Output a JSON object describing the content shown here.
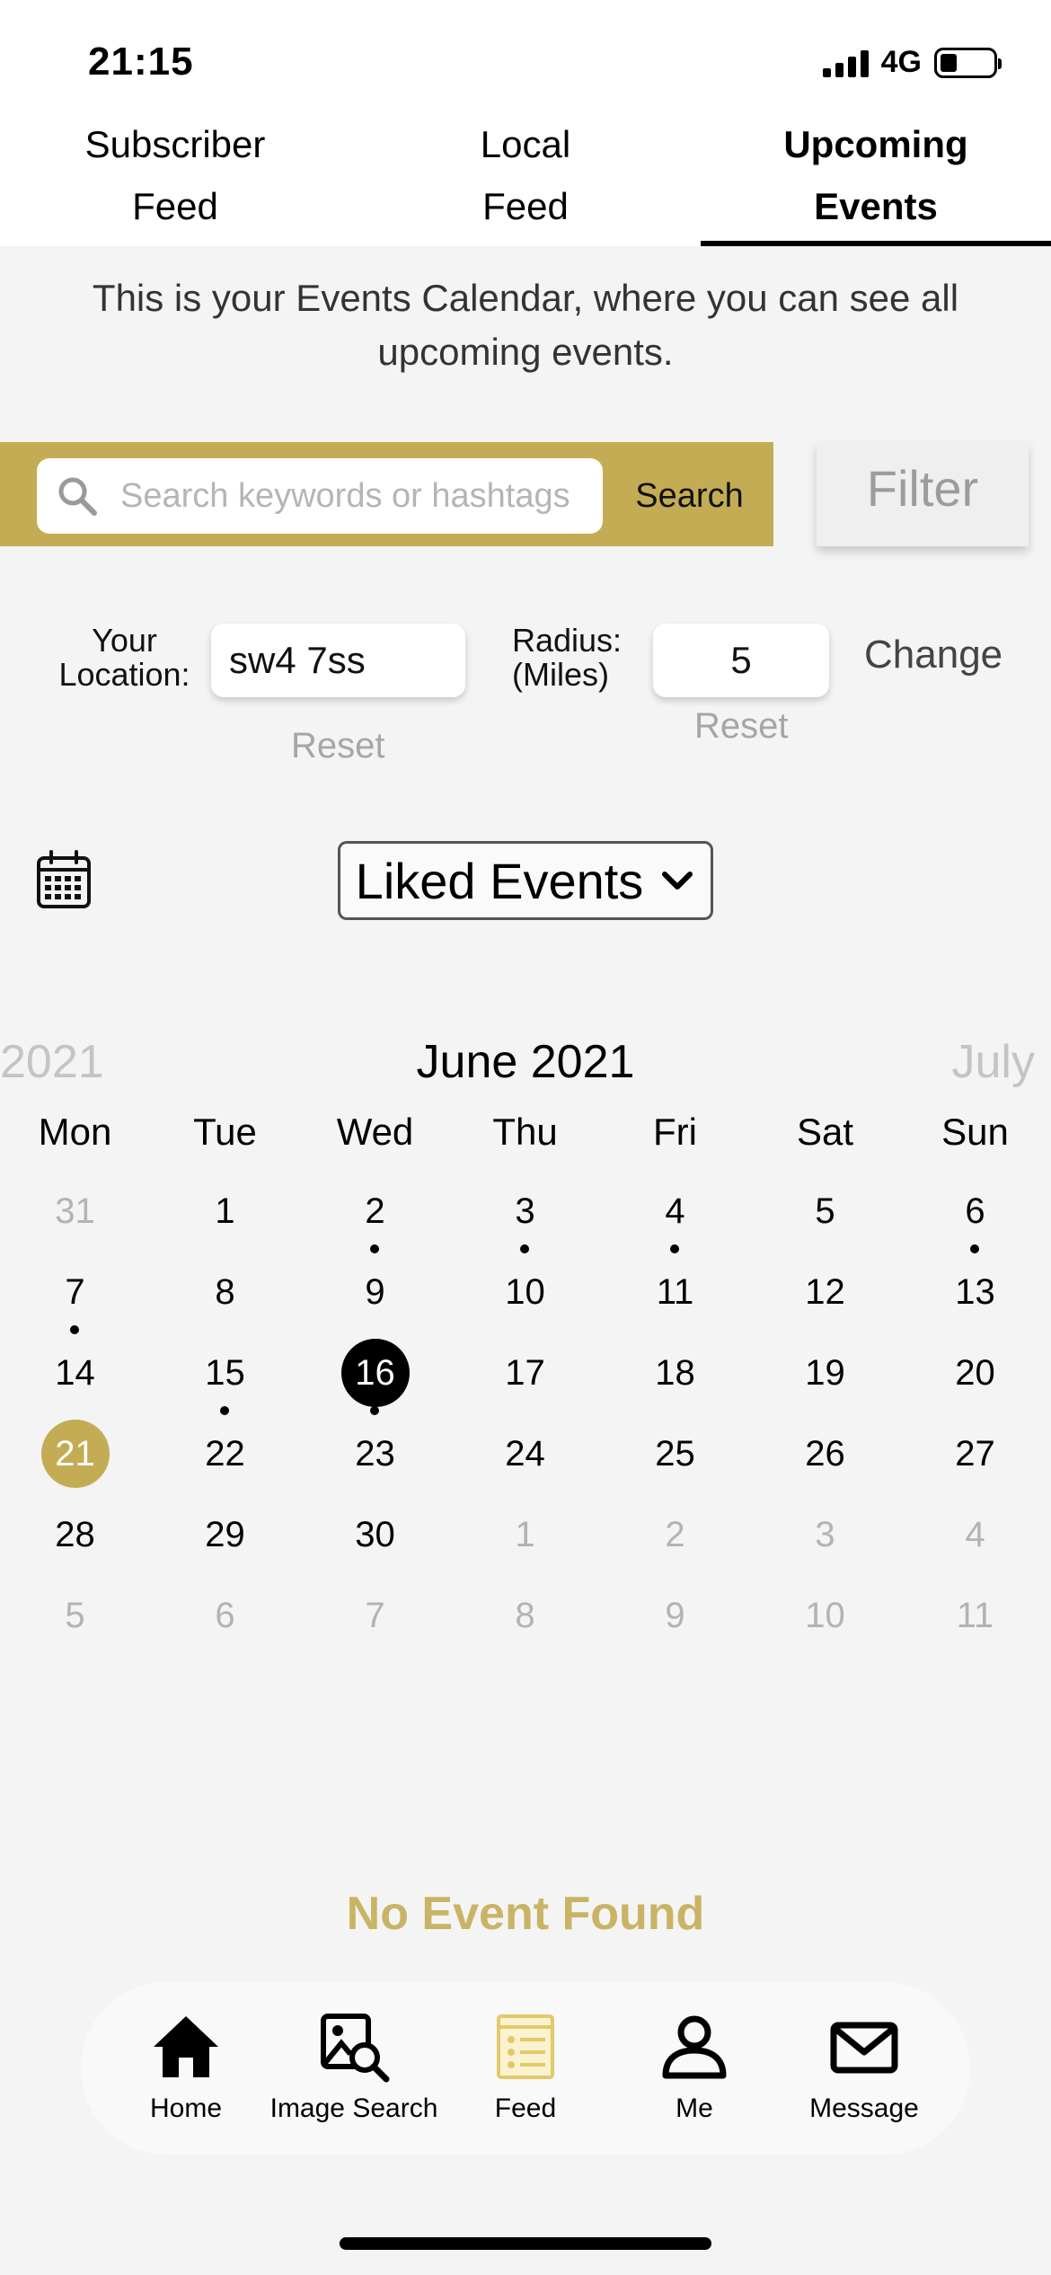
{
  "status": {
    "time": "21:15",
    "network": "4G"
  },
  "tabs": [
    {
      "line1": "Subscriber",
      "line2": "Feed",
      "active": false
    },
    {
      "line1": "Local",
      "line2": "Feed",
      "active": false
    },
    {
      "line1": "Upcoming",
      "line2": "Events",
      "active": true
    }
  ],
  "intro_text": "This is your Events Calendar, where you can see all upcoming events.",
  "search": {
    "placeholder": "Search keywords or hashtags",
    "value": "",
    "button": "Search"
  },
  "filter_label": "Filter",
  "location": {
    "label_line1": "Your",
    "label_line2": "Location:",
    "value": "sw4 7ss",
    "reset": "Reset"
  },
  "radius": {
    "label_line1": "Radius:",
    "label_line2": "(Miles)",
    "value": "5",
    "reset": "Reset",
    "change": "Change"
  },
  "dropdown": {
    "selected": "Liked Events"
  },
  "calendar": {
    "prev_month": "2021",
    "month": "June 2021",
    "next_month": "July",
    "weekdays": [
      "Mon",
      "Tue",
      "Wed",
      "Thu",
      "Fri",
      "Sat",
      "Sun"
    ],
    "weeks": [
      [
        {
          "d": "31",
          "out": true
        },
        {
          "d": "1"
        },
        {
          "d": "2",
          "dot": true
        },
        {
          "d": "3",
          "dot": true
        },
        {
          "d": "4",
          "dot": true
        },
        {
          "d": "5"
        },
        {
          "d": "6",
          "dot": true
        }
      ],
      [
        {
          "d": "7",
          "dot": true
        },
        {
          "d": "8"
        },
        {
          "d": "9"
        },
        {
          "d": "10"
        },
        {
          "d": "11"
        },
        {
          "d": "12"
        },
        {
          "d": "13"
        }
      ],
      [
        {
          "d": "14"
        },
        {
          "d": "15",
          "dot": true
        },
        {
          "d": "16",
          "selected": true,
          "dot": true
        },
        {
          "d": "17"
        },
        {
          "d": "18"
        },
        {
          "d": "19"
        },
        {
          "d": "20"
        }
      ],
      [
        {
          "d": "21",
          "today": true
        },
        {
          "d": "22"
        },
        {
          "d": "23"
        },
        {
          "d": "24"
        },
        {
          "d": "25"
        },
        {
          "d": "26"
        },
        {
          "d": "27"
        }
      ],
      [
        {
          "d": "28"
        },
        {
          "d": "29"
        },
        {
          "d": "30"
        },
        {
          "d": "1",
          "out": true
        },
        {
          "d": "2",
          "out": true
        },
        {
          "d": "3",
          "out": true
        },
        {
          "d": "4",
          "out": true
        }
      ],
      [
        {
          "d": "5",
          "out": true
        },
        {
          "d": "6",
          "out": true
        },
        {
          "d": "7",
          "out": true
        },
        {
          "d": "8",
          "out": true
        },
        {
          "d": "9",
          "out": true
        },
        {
          "d": "10",
          "out": true
        },
        {
          "d": "11",
          "out": true
        }
      ]
    ]
  },
  "no_event_text": "No Event Found",
  "nav": [
    {
      "label": "Home",
      "icon": "home-icon"
    },
    {
      "label": "Image Search",
      "icon": "image-search-icon"
    },
    {
      "label": "Feed",
      "icon": "feed-icon",
      "active": true
    },
    {
      "label": "Me",
      "icon": "person-icon"
    },
    {
      "label": "Message",
      "icon": "envelope-icon"
    }
  ],
  "colors": {
    "accent": "#c3ac54",
    "no_event": "#c9b465",
    "background": "#f4f4f4"
  }
}
